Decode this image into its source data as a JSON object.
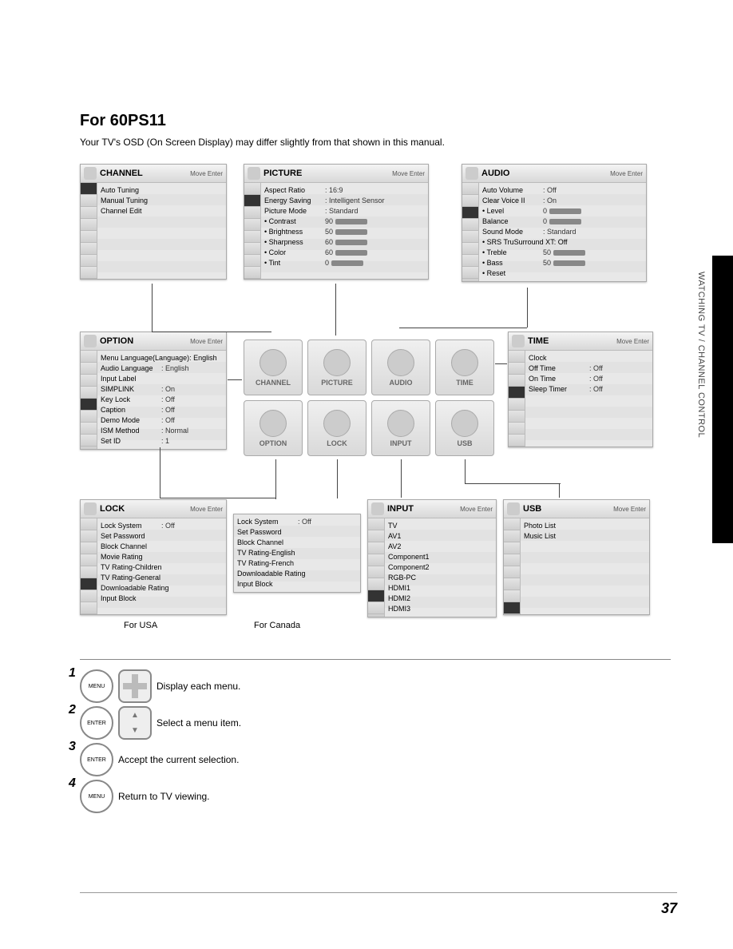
{
  "heading": "For 60PS11",
  "intro": "Your TV's OSD (On Screen Display) may differ slightly from that shown in this manual.",
  "side_label": "WATCHING TV / CHANNEL CONTROL",
  "page_number": "37",
  "panel_hint": "Move    Enter",
  "panels": {
    "channel": {
      "title": "CHANNEL",
      "items": [
        {
          "lab": "Auto Tuning"
        },
        {
          "lab": "Manual Tuning"
        },
        {
          "lab": "Channel Edit"
        }
      ]
    },
    "picture": {
      "title": "PICTURE",
      "items": [
        {
          "lab": "Aspect Ratio",
          "val": ": 16:9"
        },
        {
          "lab": "Energy Saving",
          "val": ": Intelligent Sensor"
        },
        {
          "lab": "Picture Mode",
          "val": ": Standard"
        },
        {
          "lab": "• Contrast",
          "val": "90",
          "bar": true
        },
        {
          "lab": "• Brightness",
          "val": "50",
          "bar": true
        },
        {
          "lab": "• Sharpness",
          "val": "60",
          "bar": true
        },
        {
          "lab": "• Color",
          "val": "60",
          "bar": true
        },
        {
          "lab": "• Tint",
          "val": "0",
          "bar": true
        }
      ]
    },
    "audio": {
      "title": "AUDIO",
      "items": [
        {
          "lab": "Auto Volume",
          "val": ": Off"
        },
        {
          "lab": "Clear Voice II",
          "val": ": On"
        },
        {
          "lab": "• Level",
          "val": "0",
          "bar": true
        },
        {
          "lab": "Balance",
          "val": "0",
          "bar": true
        },
        {
          "lab": "Sound Mode",
          "val": ": Standard"
        },
        {
          "lab": "• SRS TruSurround XT: Off"
        },
        {
          "lab": "• Treble",
          "val": "50",
          "bar": true
        },
        {
          "lab": "• Bass",
          "val": "50",
          "bar": true
        },
        {
          "lab": "• Reset"
        }
      ]
    },
    "option": {
      "title": "OPTION",
      "items": [
        {
          "lab": "Menu Language(Language): English"
        },
        {
          "lab": "Audio Language",
          "val": ": English"
        },
        {
          "lab": "Input Label"
        },
        {
          "lab": "SIMPLINK",
          "val": ": On"
        },
        {
          "lab": "Key Lock",
          "val": ": Off"
        },
        {
          "lab": "Caption",
          "val": ": Off"
        },
        {
          "lab": "Demo Mode",
          "val": ": Off"
        },
        {
          "lab": "ISM Method",
          "val": ": Normal"
        },
        {
          "lab": "Set ID",
          "val": ": 1"
        }
      ]
    },
    "time": {
      "title": "TIME",
      "items": [
        {
          "lab": "Clock"
        },
        {
          "lab": "Off Time",
          "val": ": Off"
        },
        {
          "lab": "On Time",
          "val": ": Off"
        },
        {
          "lab": "Sleep Timer",
          "val": ": Off"
        }
      ]
    },
    "lock_usa": {
      "title": "LOCK",
      "items": [
        {
          "lab": "Lock System",
          "val": ": Off"
        },
        {
          "lab": "Set Password"
        },
        {
          "lab": "Block Channel"
        },
        {
          "lab": "Movie Rating"
        },
        {
          "lab": "TV Rating-Children"
        },
        {
          "lab": "TV Rating-General"
        },
        {
          "lab": "Downloadable Rating"
        },
        {
          "lab": "Input Block"
        }
      ]
    },
    "lock_canada": {
      "title": "",
      "items": [
        {
          "lab": "Lock System",
          "val": ": Off"
        },
        {
          "lab": "Set Password"
        },
        {
          "lab": "Block Channel"
        },
        {
          "lab": "TV Rating-English"
        },
        {
          "lab": "TV Rating-French"
        },
        {
          "lab": "Downloadable Rating"
        },
        {
          "lab": "Input Block"
        }
      ]
    },
    "input": {
      "title": "INPUT",
      "items": [
        {
          "lab": "TV"
        },
        {
          "lab": "AV1"
        },
        {
          "lab": "AV2"
        },
        {
          "lab": "Component1"
        },
        {
          "lab": "Component2"
        },
        {
          "lab": "RGB-PC"
        },
        {
          "lab": "HDMI1"
        },
        {
          "lab": "HDMI2"
        },
        {
          "lab": "HDMI3"
        }
      ]
    },
    "usb": {
      "title": "USB",
      "items": [
        {
          "lab": "Photo List"
        },
        {
          "lab": "Music List"
        }
      ]
    }
  },
  "hub": [
    "CHANNEL",
    "PICTURE",
    "AUDIO",
    "TIME",
    "OPTION",
    "LOCK",
    "INPUT",
    "USB"
  ],
  "captions": {
    "usa": "For USA",
    "canada": "For Canada"
  },
  "steps": [
    {
      "num": "1",
      "btn": "MENU",
      "extra": "dpad",
      "text": "Display each menu."
    },
    {
      "num": "2",
      "btn": "ENTER",
      "extra": "arrows",
      "text": "Select a menu item."
    },
    {
      "num": "3",
      "btn": "ENTER",
      "text": "Accept the current selection."
    },
    {
      "num": "4",
      "btn": "MENU",
      "text": "Return to TV viewing."
    }
  ]
}
